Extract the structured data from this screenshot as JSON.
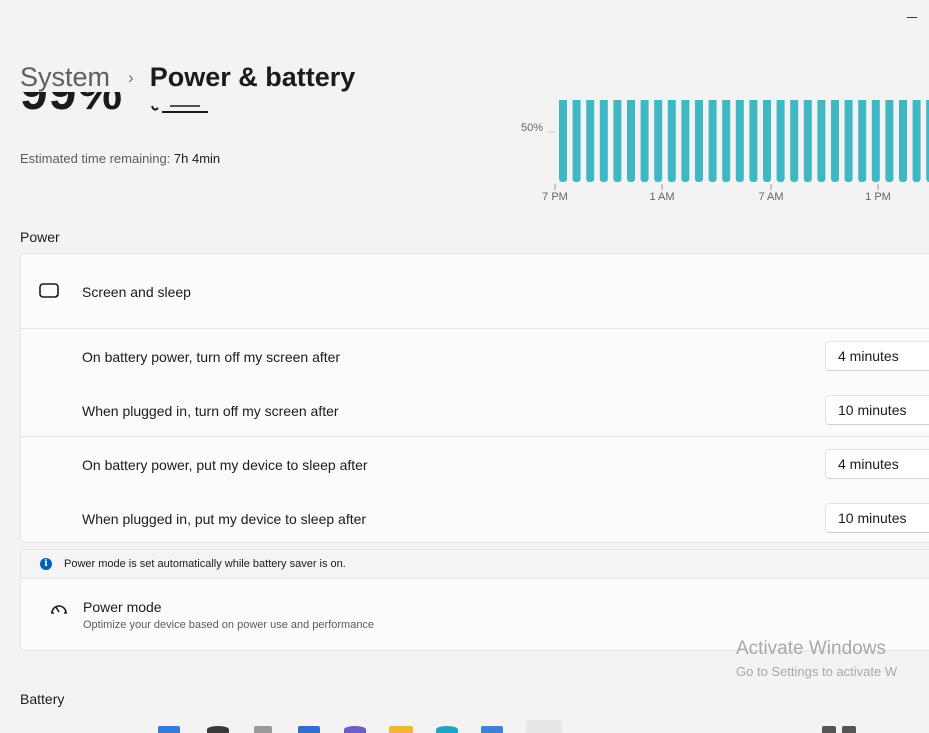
{
  "window": {
    "minimize_glyph": "–"
  },
  "breadcrumb": {
    "parent": "System",
    "separator": "›",
    "current": "Power & battery"
  },
  "battery_summary": {
    "percent_text": "99%",
    "estimated_label": "Estimated time remaining:",
    "estimated_value": "7h 4min"
  },
  "chart_data": {
    "type": "bar",
    "y_tick_labels": [
      "50%"
    ],
    "x_tick_labels": [
      "7 PM",
      "1 AM",
      "7 AM",
      "1 PM"
    ],
    "bar_color": "#3fb8c4",
    "values": [
      99,
      99,
      99,
      99,
      99,
      99,
      99,
      99,
      99,
      99,
      99,
      99,
      99,
      99,
      99,
      99,
      99,
      99,
      99,
      99,
      99,
      99,
      99,
      99,
      99,
      99,
      99,
      99,
      99,
      99,
      99
    ],
    "ylim": [
      0,
      100
    ]
  },
  "power_section": {
    "title": "Power",
    "screen_sleep": {
      "title": "Screen and sleep",
      "icon": "screen-sleep-icon",
      "settings": [
        {
          "label": "On battery power, turn off my screen after",
          "value": "4 minutes"
        },
        {
          "label": "When plugged in, turn off my screen after",
          "value": "10 minutes"
        },
        {
          "label": "On battery power, put my device to sleep after",
          "value": "4 minutes"
        },
        {
          "label": "When plugged in, put my device to sleep after",
          "value": "10 minutes"
        }
      ]
    },
    "info": {
      "icon_glyph": "i",
      "text": "Power mode is set automatically while battery saver is on."
    },
    "power_mode": {
      "title": "Power mode",
      "description": "Optimize your device based on power use and performance",
      "icon": "gauge-icon"
    }
  },
  "battery_section": {
    "title": "Battery"
  },
  "watermark": {
    "line1": "Activate Windows",
    "line2": "Go to Settings to activate W"
  },
  "colors": {
    "accent": "#005fb8",
    "chart_bar": "#3fb8c4",
    "background": "#f3f3f3",
    "card": "#fbfbfb"
  }
}
